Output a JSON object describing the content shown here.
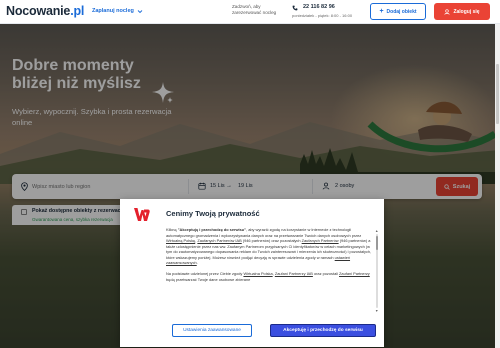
{
  "header": {
    "logo_main": "Nocowanie",
    "logo_tld": ".pl",
    "plan_label": "Zaplanuj nocleg",
    "help_line1": "Zadzwoń, aby",
    "help_line2": "zarezerwować nocleg",
    "phone": "22 116 82 96",
    "hours": "poniedziałek - piątek: 8:00 - 16:00",
    "add_label": "Dodaj obiekt",
    "login_label": "Zaloguj się"
  },
  "hero": {
    "headline_line1": "Dobre momenty",
    "headline_line2": "bliżej niż myślisz",
    "subtitle": "Wybierz, wypocznij. Szybka i prosta rezerwacja online"
  },
  "search": {
    "placeholder": "Wpisz miasto lub region",
    "date_from": "15 Lis",
    "date_to": "19 Lis",
    "guests": "2 osoby",
    "button_label": "Szukaj"
  },
  "filter": {
    "label": "Pokaż dostępne obiekty z rezerwacją online",
    "sublabel": "Gwarantowana cena, szybka rezerwacja"
  },
  "consent": {
    "title": "Cenimy Twoją prywatność",
    "p1_a": "Klikną ",
    "p1_bold": "\"Akceptuję i przechodzę do serwisu\"",
    "p1_b": ", aby wyrazić zgodę na korzystanie w Internecie z technologii automatycznego gromadzenia i wykorzystywania danych oraz na przetwarzanie Twoich danych osobowych przez ",
    "p1_link1": "Wirtualną Polskę",
    "p1_c": ", ",
    "p1_link2": "Zaufanych Partnerów IAB",
    "p1_d": " (946 partnerów) oraz pozostałych ",
    "p1_link3": "Zaufanych Partnerów",
    "p1_e": " (946 partnerów) a także udostępnienie przez nas ww. Zaufanym Partnerom przypisanych Ci identyfikatorów w celach marketingowych (w tym do zautomatyzowanego dopasowania reklam do Twoich zainteresowań i mierzenia ich skuteczności) i pozostałych, które wskazujemy poniżej. Możesz również podjąć decyzję w sprawie udzielenia zgody w ramach ",
    "p1_link4": "ustawień zaawansowanych",
    "p1_f": ".",
    "p2_a": "Na podstawie udzielonej przez Ciebie zgody ",
    "p2_link1": "Wirtualna Polska",
    "p2_b": ", ",
    "p2_link2": "Zaufani Partnerzy IAB",
    "p2_c": " oraz pozostali ",
    "p2_link3": "Zaufani Partnerzy",
    "p2_d": " będą przetwarzać Twoje dane osobowe zbierane",
    "adv_label": "Ustawienia zaawansowane",
    "accept_label": "Akceptuję i przechodzę do serwisu"
  },
  "colors": {
    "brand_blue": "#1a6bd8",
    "accent_red": "#ea4335",
    "accept_blue": "#3b4fe0",
    "wp_red": "#e4202c"
  },
  "icons": [
    "chevron-down-icon",
    "plus-icon",
    "user-icon",
    "phone-icon",
    "sparkle-icon",
    "search-icon",
    "calendar-icon",
    "arrow-right-icon",
    "guests-icon",
    "bolt-icon",
    "wp-logo-icon"
  ]
}
